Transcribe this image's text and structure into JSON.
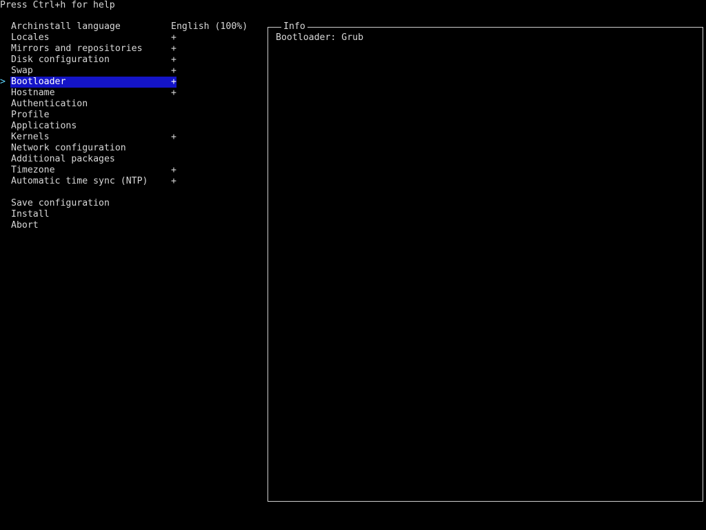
{
  "header": {
    "help_text": "Press Ctrl+h for help"
  },
  "menu": {
    "cursor_glyph": ">",
    "items": [
      {
        "label": "Archinstall language",
        "status": "English (100%)"
      },
      {
        "label": "Locales",
        "status": "+"
      },
      {
        "label": "Mirrors and repositories",
        "status": "+"
      },
      {
        "label": "Disk configuration",
        "status": "+"
      },
      {
        "label": "Swap",
        "status": "+"
      },
      {
        "label": "Bootloader",
        "status": "+"
      },
      {
        "label": "Hostname",
        "status": "+"
      },
      {
        "label": "Authentication",
        "status": ""
      },
      {
        "label": "Profile",
        "status": ""
      },
      {
        "label": "Applications",
        "status": ""
      },
      {
        "label": "Kernels",
        "status": "+"
      },
      {
        "label": "Network configuration",
        "status": ""
      },
      {
        "label": "Additional packages",
        "status": ""
      },
      {
        "label": "Timezone",
        "status": "+"
      },
      {
        "label": "Automatic time sync (NTP)",
        "status": "+"
      }
    ],
    "actions": [
      {
        "label": "Save configuration"
      },
      {
        "label": "Install"
      },
      {
        "label": "Abort"
      }
    ]
  },
  "info": {
    "title": "Info",
    "content": "Bootloader: Grub"
  },
  "colors": {
    "background": "#000000",
    "text": "#d8d8d8",
    "selection": "#1414c8",
    "cursor": "#5fd7ff"
  }
}
